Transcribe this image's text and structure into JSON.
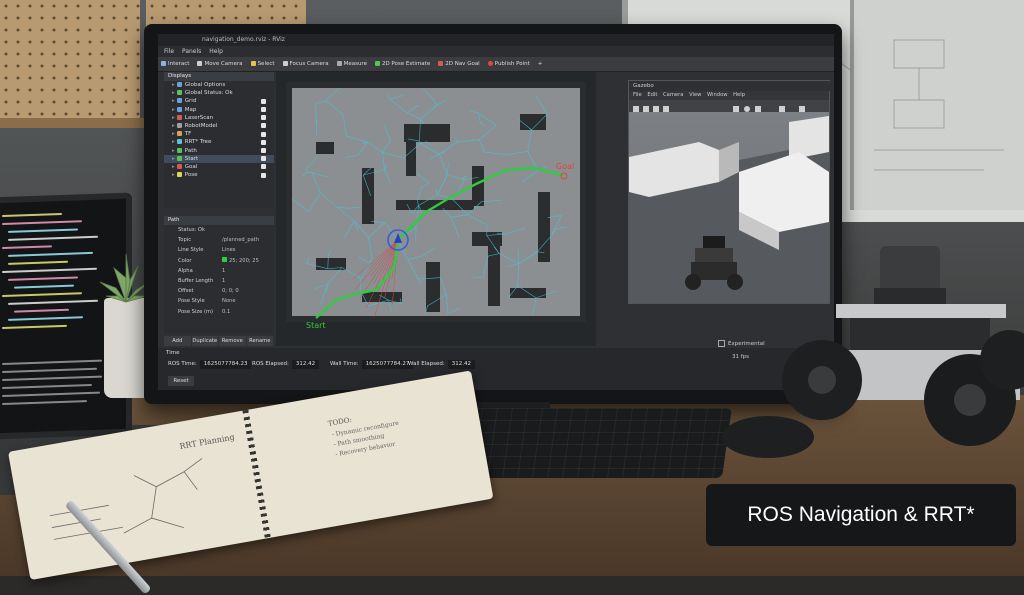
{
  "window": {
    "title": "navigation_demo.rviz - RViz"
  },
  "menu": {
    "file": "File",
    "panels": "Panels",
    "help": "Help"
  },
  "toolbar": {
    "items": [
      "Interact",
      "Move Camera",
      "Select",
      "Focus Camera",
      "Measure",
      "2D Pose Estimate",
      "2D Nav Goal",
      "Publish Point"
    ]
  },
  "displays": {
    "title": "Displays",
    "items": [
      {
        "label": "Global Options",
        "color": "#6aa0d8"
      },
      {
        "label": "Global Status: Ok",
        "color": "#58c258"
      },
      {
        "label": "Grid",
        "color": "#6aa0d8"
      },
      {
        "label": "Map",
        "color": "#6aa0d8"
      },
      {
        "label": "LaserScan",
        "color": "#d85858"
      },
      {
        "label": "RobotModel",
        "color": "#a0a0a0"
      },
      {
        "label": "TF",
        "color": "#d8a058"
      },
      {
        "label": "RRT* Tree",
        "color": "#58c2d8"
      },
      {
        "label": "Path",
        "color": "#58c258"
      },
      {
        "label": "Start",
        "color": "#58c258"
      },
      {
        "label": "Goal",
        "color": "#d85858"
      },
      {
        "label": "Pose",
        "color": "#d8d858"
      }
    ]
  },
  "properties": {
    "title": "Path",
    "rows": [
      {
        "k": "Status: Ok",
        "v": ""
      },
      {
        "k": "Topic",
        "v": "/planned_path"
      },
      {
        "k": "Line Style",
        "v": "Lines"
      },
      {
        "k": "Color",
        "v": "25; 200; 25"
      },
      {
        "k": "Alpha",
        "v": "1"
      },
      {
        "k": "Buffer Length",
        "v": "1"
      },
      {
        "k": "Offset",
        "v": "0; 0; 0"
      },
      {
        "k": "Pose Style",
        "v": "None"
      },
      {
        "k": "Pose Size (m)",
        "v": "0.1"
      }
    ]
  },
  "panel_buttons": [
    "Add",
    "Duplicate",
    "Remove",
    "Rename"
  ],
  "time": {
    "title": "Time",
    "ros_time_label": "ROS Time:",
    "ros_time": "1625077784.23",
    "ros_elapsed_label": "ROS Elapsed:",
    "ros_elapsed": "312.42",
    "wall_time_label": "Wall Time:",
    "wall_time": "1625077784.27",
    "wall_elapsed_label": "Wall Elapsed:",
    "wall_elapsed": "312.42",
    "reset": "Reset",
    "experimental": "Experimental",
    "fps": "31 fps"
  },
  "map": {
    "start_label": "Start",
    "goal_label": "Goal",
    "path_color": "#2ecc40",
    "tree_color": "#3fc7d8",
    "goal_color": "#e8413a"
  },
  "gazebo": {
    "title": "Gazebo",
    "menu": [
      "File",
      "Edit",
      "Camera",
      "View",
      "Window",
      "Help"
    ]
  },
  "notebook": {
    "heading": "RRT Planning",
    "todo_title": "TODO:",
    "todo": [
      "- Dynamic reconfigure",
      "- Path smoothing",
      "- Recovery behavior"
    ]
  },
  "caption": "ROS Navigation & RRT*"
}
